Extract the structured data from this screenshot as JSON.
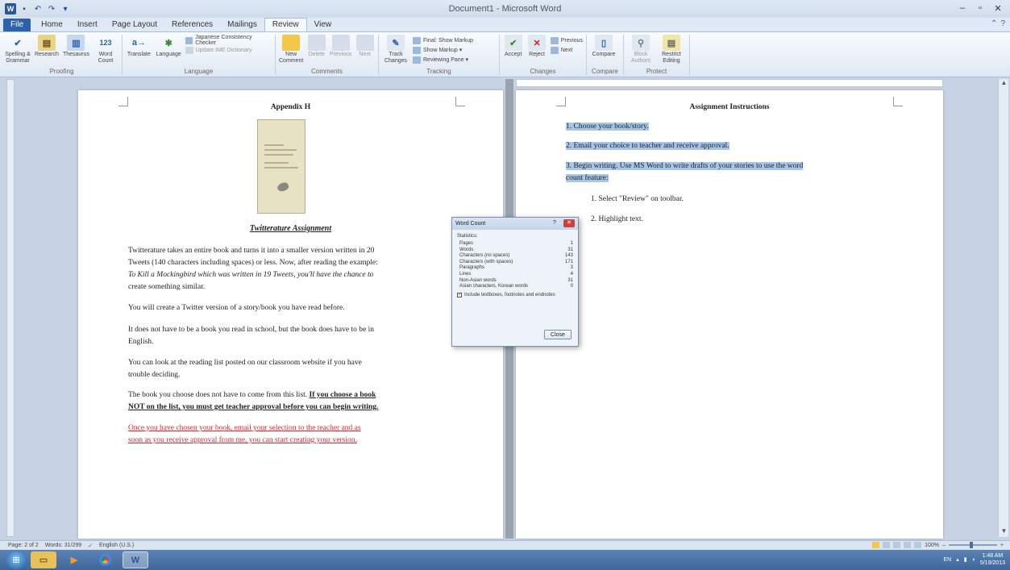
{
  "window": {
    "title": "Document1 - Microsoft Word",
    "qat": [
      "save-icon",
      "undo-icon",
      "redo-icon",
      "customize-icon"
    ],
    "controls": [
      "minimize-icon",
      "maximize-icon",
      "close-icon"
    ]
  },
  "tabs": [
    "File",
    "Home",
    "Insert",
    "Page Layout",
    "References",
    "Mailings",
    "Review",
    "View"
  ],
  "active_tab": "Review",
  "ribbon": {
    "proofing": {
      "label": "Proofing",
      "buttons": [
        "Spelling & Grammar",
        "Research",
        "Thesaurus",
        "Word Count"
      ]
    },
    "language": {
      "label": "Language",
      "buttons": [
        "Translate",
        "Language"
      ],
      "rows": [
        "Japanese Consistency Checker",
        "Update IME Dictionary"
      ]
    },
    "comments": {
      "label": "Comments",
      "buttons": [
        "New Comment",
        "Delete",
        "Previous",
        "Next"
      ]
    },
    "tracking": {
      "label": "Tracking",
      "buttons": [
        "Track Changes"
      ],
      "rows": [
        "Final: Show Markup",
        "Show Markup ▾",
        "Reviewing Pane ▾"
      ]
    },
    "changes": {
      "label": "Changes",
      "buttons": [
        "Accept",
        "Reject"
      ],
      "rows": [
        "Previous",
        "Next"
      ]
    },
    "compare": {
      "label": "Compare",
      "buttons": [
        "Compare"
      ]
    },
    "protect": {
      "label": "Protect",
      "buttons": [
        "Block Authors",
        "Restrict Editing"
      ]
    }
  },
  "left_page": {
    "appendix": "Appendix H",
    "assignment_title": "Twitterature Assignment",
    "p1_lines": [
      "Twitterature takes an entire book and turns it into a smaller version written in 20",
      "Tweets (140 characters including spaces) or less. Now, after reading the example:",
      "To Kill a Mockingbird which was written in 19 Tweets, you'll have the chance to",
      "create something similar."
    ],
    "p2": "You will create a Twitter version of a story/book you have read before.",
    "p3_lines": [
      "It does not have to be a book you read in school, but the book does have to be in",
      "English."
    ],
    "p4_lines": [
      "You can look at the reading list posted on our classroom website if you have",
      "trouble deciding."
    ],
    "p5_plain": "The book you choose does not have to come from this list. ",
    "p5_bold_line1": "If you choose a book",
    "p5_bold_line2": "NOT on the list, you must get teacher approval before you can begin writing.",
    "p6_red_lines": [
      "Once you have chosen your book, email your selection to the teacher and as",
      "soon as you receive approval from me, you can start creating your version."
    ]
  },
  "right_page": {
    "title": "Assignment Instructions",
    "item1": "1. Choose your book/story.",
    "item2": "2. Email your choice to teacher and receive approval.",
    "item3_line1": "3. Begin writing. Use MS Word to write drafts of your stories to use the word",
    "item3_line2": "count feature:",
    "sub1": "1. Select \"Review\" on toolbar.",
    "sub2": "2. Highlight text."
  },
  "word_count": {
    "title": "Word Count",
    "stats_label": "Statistics:",
    "rows": [
      {
        "label": "Pages",
        "value": "1"
      },
      {
        "label": "Words",
        "value": "31"
      },
      {
        "label": "Characters (no spaces)",
        "value": "143"
      },
      {
        "label": "Characters (with spaces)",
        "value": "171"
      },
      {
        "label": "Paragraphs",
        "value": "3"
      },
      {
        "label": "Lines",
        "value": "4"
      },
      {
        "label": "Non-Asian words",
        "value": "31"
      },
      {
        "label": "Asian characters, Korean words",
        "value": "0"
      }
    ],
    "checkbox_label": "Include textboxes, footnotes and endnotes",
    "checkbox_checked": true,
    "close_label": "Close"
  },
  "status_bar": {
    "page": "Page: 2 of 2",
    "words": "Words: 31/299",
    "language": "English (U.S.)",
    "zoom": "100%"
  },
  "taskbar": {
    "apps": [
      "windows-start-icon",
      "file-explorer-icon",
      "media-player-icon",
      "chrome-icon",
      "word-icon"
    ],
    "clock_time": "1:48 AM",
    "clock_date": "5/19/2013"
  }
}
